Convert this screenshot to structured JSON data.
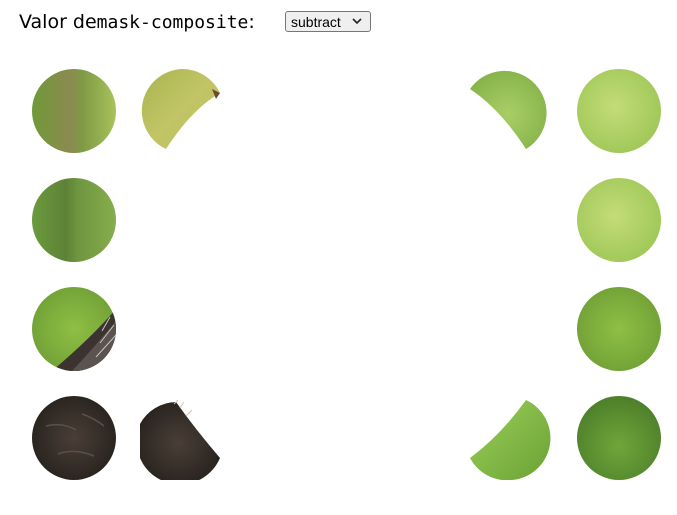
{
  "header": {
    "label_prefix": "Valor de ",
    "property_name": "mask-composite",
    "label_suffix": ":"
  },
  "composite_select": {
    "selected": "subtract",
    "chevron_icon": "chevron-down-icon"
  },
  "palette": {
    "green_light": "#b9d36a",
    "green_mid": "#8db24a",
    "green_dark": "#5f8a2c",
    "bark_dark": "#2a241f",
    "bark_mid": "#4a3e35"
  }
}
